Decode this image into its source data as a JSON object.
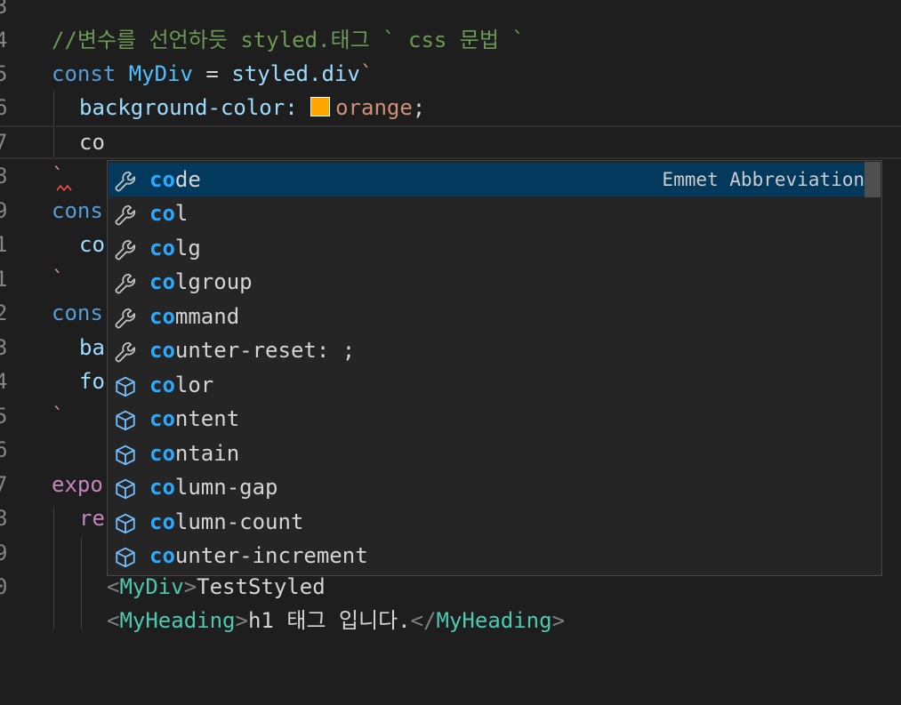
{
  "editor": {
    "line_numbers": [
      "3",
      "4",
      "5",
      "6",
      "7",
      "8",
      "9",
      "10",
      "1",
      "2",
      "3",
      "4",
      "5",
      "6",
      "7",
      "8",
      "9",
      "0"
    ],
    "code": {
      "comment_line": "//변수를 선언하듯 styled.태그 ` css 문법 `",
      "kw_const": "const",
      "mydiv": "MyDiv",
      "equals": " = ",
      "styled_div": "styled.div",
      "tick": "`",
      "bg_prop": "background-color: ",
      "orange": "orange",
      "semicolon": ";",
      "typed": "co",
      "cons_1": "cons",
      "co_1": "co",
      "cons_2": "cons",
      "ba": "ba",
      "fo": "fo",
      "expo": "expo",
      "re": "re",
      "lt": "<",
      "gt": ">",
      "lt_slash": "</",
      "mydiv_tag": "MyDiv",
      "test_styled": "TestStyled",
      "myheading_tag": "MyHeading",
      "h1_text": "h1 태그 입니다."
    },
    "colors": {
      "swatch": "#ffa500",
      "selected_bg": "#04395e",
      "highlight": "#2aaaff"
    }
  },
  "suggest": {
    "detail": "Emmet Abbreviation",
    "items": [
      {
        "match": "co",
        "rest": "de",
        "icon": "wrench-icon"
      },
      {
        "match": "co",
        "rest": "l",
        "icon": "wrench-icon"
      },
      {
        "match": "co",
        "rest": "lg",
        "icon": "wrench-icon"
      },
      {
        "match": "co",
        "rest": "lgroup",
        "icon": "wrench-icon"
      },
      {
        "match": "co",
        "rest": "mmand",
        "icon": "wrench-icon"
      },
      {
        "match": "co",
        "rest": "unter-reset: ;",
        "icon": "wrench-icon"
      },
      {
        "match": "co",
        "rest": "lor",
        "icon": "cube-icon"
      },
      {
        "match": "co",
        "rest": "ntent",
        "icon": "cube-icon"
      },
      {
        "match": "co",
        "rest": "ntain",
        "icon": "cube-icon"
      },
      {
        "match": "co",
        "rest": "lumn-gap",
        "icon": "cube-icon"
      },
      {
        "match": "co",
        "rest": "lumn-count",
        "icon": "cube-icon"
      },
      {
        "match": "co",
        "rest": "unter-increment",
        "icon": "cube-icon"
      }
    ]
  }
}
